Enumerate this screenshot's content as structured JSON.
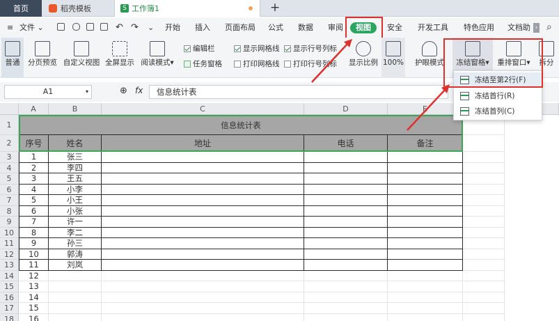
{
  "tabs": [
    {
      "label": "首页"
    },
    {
      "label": "稻壳模板"
    },
    {
      "label": "工作簿1"
    }
  ],
  "tab_icon_letter": "S",
  "menu": {
    "file": "文件",
    "items": [
      "开始",
      "插入",
      "页面布局",
      "公式",
      "数据",
      "审阅",
      "视图",
      "安全",
      "开发工具",
      "特色应用",
      "文档助"
    ]
  },
  "ribbon": {
    "normal": "普通",
    "page_break": "分页预览",
    "custom_view": "自定义视图",
    "fullscreen": "全屏显示",
    "reading": "阅读模式",
    "chk_editbar": "编辑栏",
    "chk_taskpane": "任务窗格",
    "chk_gridlines": "显示网格线",
    "chk_printgrid": "打印网格线",
    "chk_rowcol": "显示行号列标",
    "chk_printrowcol": "打印行号列标",
    "zoom_ratio": "显示比例",
    "zoom_value": "100%",
    "eye_mode": "护眼模式",
    "freeze": "冻结窗格",
    "rearrange": "重排窗口",
    "split": "拆分"
  },
  "freeze_menu": [
    "冻结至第2行(F)",
    "冻结首行(R)",
    "冻结首列(C)"
  ],
  "formula_bar": {
    "name_box": "A1",
    "fx": "fx",
    "content": "信息统计表"
  },
  "columns": [
    "A",
    "B",
    "C",
    "D",
    "E"
  ],
  "sheet": {
    "title": "信息统计表",
    "headers": [
      "序号",
      "姓名",
      "地址",
      "电话",
      "备注"
    ],
    "rows": [
      [
        "1",
        "张三"
      ],
      [
        "2",
        "李四"
      ],
      [
        "3",
        "王五"
      ],
      [
        "4",
        "小李"
      ],
      [
        "5",
        "小王"
      ],
      [
        "6",
        "小张"
      ],
      [
        "7",
        "许一"
      ],
      [
        "8",
        "李二"
      ],
      [
        "9",
        "孙三"
      ],
      [
        "10",
        "郭涛"
      ],
      [
        "11",
        "刘岚"
      ]
    ],
    "extra_row_numbers": [
      "12",
      "13",
      "14",
      "15",
      "16"
    ]
  },
  "colors": {
    "accent": "#2aa660",
    "highlight": "#e0302c",
    "header_bg": "#a6a6a6"
  }
}
